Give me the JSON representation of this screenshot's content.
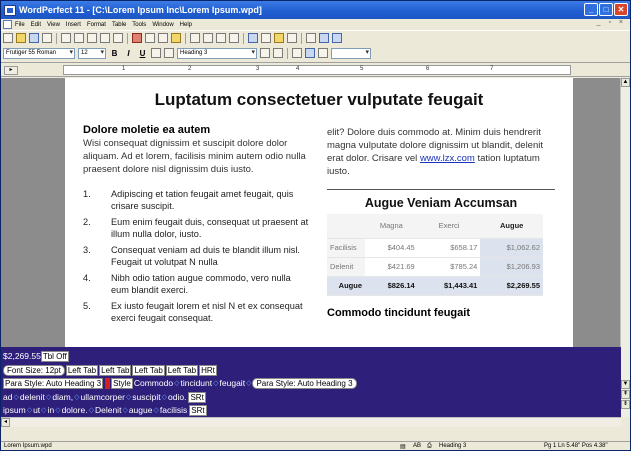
{
  "window": {
    "title": "WordPerfect 11 - [C:\\Lorem Ipsum Inc\\Lorem Ipsum.wpd]"
  },
  "menu": [
    "File",
    "Edit",
    "View",
    "Insert",
    "Format",
    "Table",
    "Tools",
    "Window",
    "Help"
  ],
  "property_bar": {
    "font_face": "Frutiger 55 Roman",
    "font_size": "12",
    "bold": "B",
    "italic": "I",
    "underline": "U",
    "style": "Heading 3"
  },
  "ruler": {
    "marks": [
      "1",
      "2",
      "3",
      "4",
      "5",
      "6",
      "7"
    ]
  },
  "document": {
    "title": "Luptatum consectetuer vulputate feugait",
    "left": {
      "heading": "Dolore moletie ea autem",
      "paragraph": "Wisi consequat dignissim et suscipit dolore dolor aliquam. Ad et lorem, facilisis minim autem odio nulla praesent dolore nisl dignissim duis iusto.",
      "list": [
        {
          "num": "1.",
          "text": "Adipiscing et tation feugait amet feugait, quis crisare suscipit."
        },
        {
          "num": "2.",
          "text": "Eum enim feugait duis, consequat ut praesent at illum nulla dolor, iusto."
        },
        {
          "num": "3.",
          "text": "Consequat veniam ad duis te blandit illum nisl. Feugait ut volutpat N nulla"
        },
        {
          "num": "4.",
          "text": "Nibh odio tation augue commodo, vero nulla eum blandit exerci."
        },
        {
          "num": "5.",
          "text": "Ex iusto feugait lorem et nisl N et ex consequat exerci feugait consequat."
        }
      ]
    },
    "right": {
      "paragraph_before": "elit? Dolore duis commodo at. Minim duis hendrerit magna vulputate dolore dignissim ut blandit, delenit erat dolor. Crisare vel ",
      "link": "www.lzx.com",
      "paragraph_after": " tation luptatum iusto.",
      "table": {
        "title": "Augue Veniam Accumsan",
        "columns": [
          "",
          "Magna",
          "Exerci",
          "Augue"
        ],
        "rows": [
          [
            "Facilisis",
            "$404.45",
            "$658.17",
            "$1,062.62"
          ],
          [
            "Delenit",
            "$421.69",
            "$785.24",
            "$1,206.93"
          ]
        ],
        "total": [
          "Augue",
          "$826.14",
          "$1,443.41",
          "$2,269.55"
        ]
      },
      "heading2": "Commodo tincidunt feugait"
    }
  },
  "reveal_codes": {
    "line1": {
      "text": "$2,269.55",
      "code": "Tbl Off"
    },
    "line2": {
      "font_size": "Font Size: 12pt",
      "tabs": [
        "Left Tab",
        "Left Tab",
        "Left Tab",
        "Left Tab"
      ],
      "hrt": "HRt"
    },
    "line3": {
      "para_style_a": "Para Style: Auto Heading 3",
      "style": "Style",
      "words": [
        "Commodo",
        "tincidunt",
        "feugait"
      ],
      "para_style_b": "Para Style: Auto Heading 3"
    },
    "line4": {
      "words": [
        "ad",
        "delenit",
        "diam,",
        "ullamcorper",
        "suscipit",
        "odio."
      ],
      "srt": "SRt"
    },
    "line5": {
      "words": [
        "ipsum",
        "ut",
        "in",
        "dolore.",
        "Delenit",
        "augue",
        "facilisis"
      ],
      "srt": "SRt"
    }
  },
  "status": {
    "document": "Lorem Ipsum.wpd",
    "insert": "AB",
    "style": "Heading 3",
    "position": "Pg 1 Ln 5.48\" Pos 4.38\""
  }
}
